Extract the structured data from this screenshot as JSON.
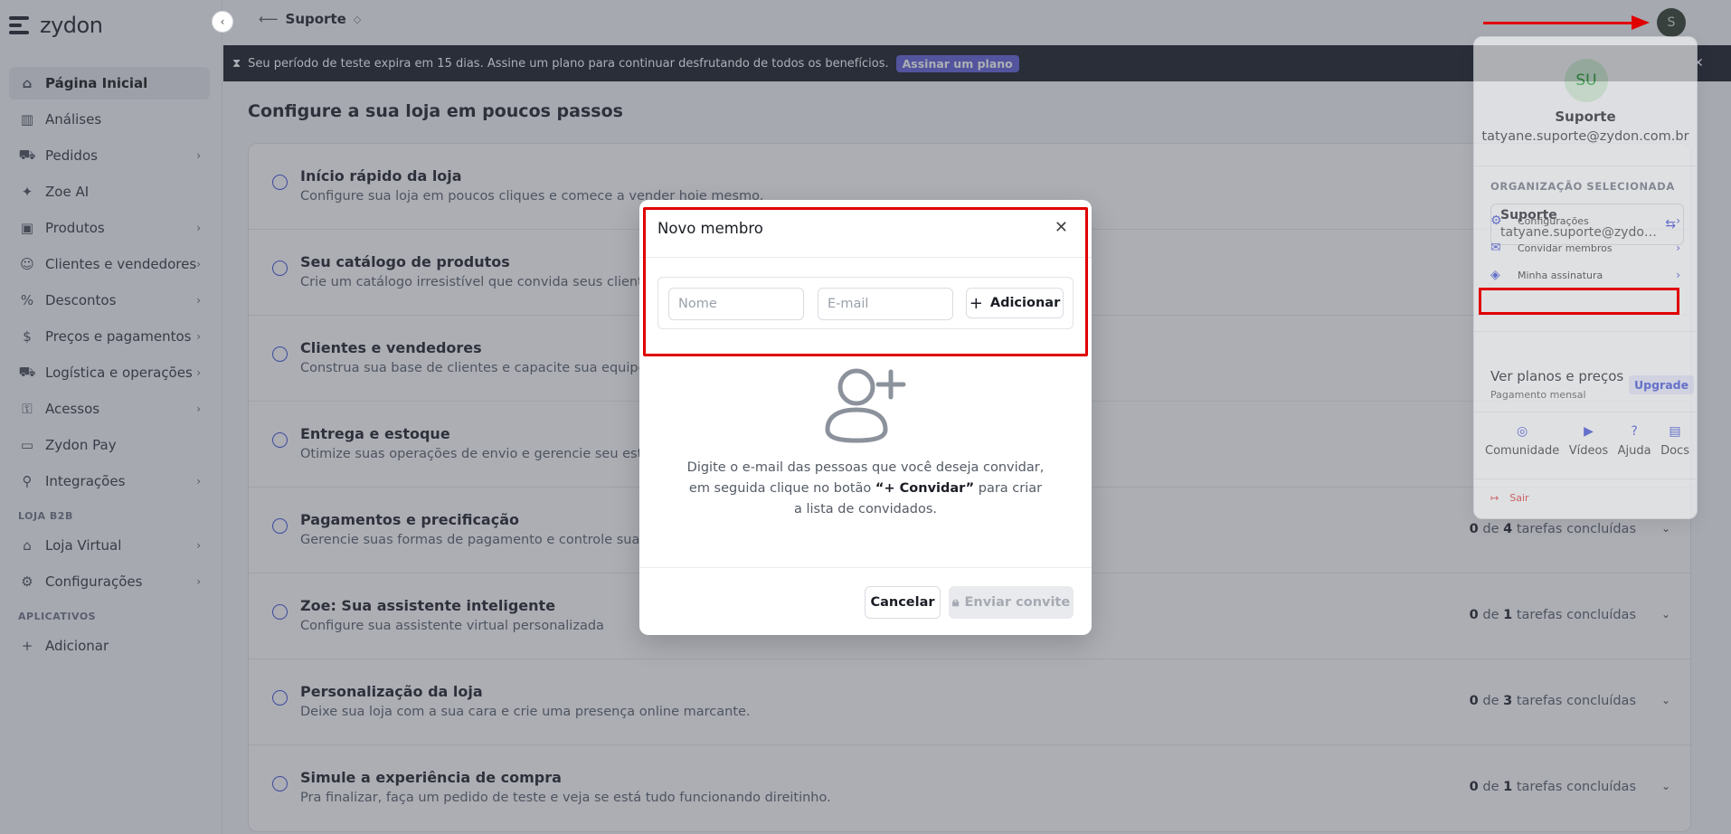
{
  "brand": {
    "name": "zydon"
  },
  "breadcrumb": {
    "back": "⟵",
    "title": "Suporte"
  },
  "user": {
    "initial": "S"
  },
  "sidebar": {
    "items": [
      {
        "label": "Página Inicial",
        "icon": "home-icon",
        "active": true,
        "chevron": false
      },
      {
        "label": "Análises",
        "icon": "bar-chart-icon",
        "chevron": false
      },
      {
        "label": "Pedidos",
        "icon": "cart-icon",
        "chevron": true
      },
      {
        "label": "Zoe AI",
        "icon": "sparkle-icon",
        "chevron": false
      },
      {
        "label": "Produtos",
        "icon": "box-icon",
        "chevron": true
      },
      {
        "label": "Clientes e vendedores",
        "icon": "users-icon",
        "chevron": true
      },
      {
        "label": "Descontos",
        "icon": "percent-icon",
        "chevron": true
      },
      {
        "label": "Preços e pagamentos",
        "icon": "dollar-icon",
        "chevron": true
      },
      {
        "label": "Logística e operações",
        "icon": "truck-icon",
        "chevron": true
      },
      {
        "label": "Acessos",
        "icon": "key-icon",
        "chevron": true
      },
      {
        "label": "Zydon Pay",
        "icon": "wallet-icon",
        "chevron": false
      },
      {
        "label": "Integrações",
        "icon": "plug-icon",
        "chevron": true
      }
    ],
    "section_b2b": "LOJA B2B",
    "b2b_items": [
      {
        "label": "Loja Virtual",
        "icon": "store-icon",
        "chevron": true
      },
      {
        "label": "Configurações",
        "icon": "gear-icon",
        "chevron": true
      }
    ],
    "section_apps": "APLICATIVOS",
    "apps_items": [
      {
        "label": "Adicionar",
        "icon": "plus-icon",
        "chevron": false
      }
    ]
  },
  "banner": {
    "text": "Seu período de teste expira em 15 dias. Assine um plano para continuar desfrutando de todos os benefícios.",
    "cta": "Assinar um plano"
  },
  "main": {
    "title": "Configure a sua loja em poucos passos",
    "tasks": [
      {
        "title": "Início rápido da loja",
        "desc": "Configure sua loja em poucos cliques e comece a vender hoje mesmo.",
        "done": "",
        "total": "",
        "suffix": ""
      },
      {
        "title": "Seu catálogo de produtos",
        "desc": "Crie um catálogo irresistível que convida seus clientes a comprar.",
        "done": "",
        "total": "",
        "suffix": ""
      },
      {
        "title": "Clientes e vendedores",
        "desc": "Construa sua base de clientes e capacite sua equipe de vendas.",
        "done": "",
        "total": "",
        "suffix": ""
      },
      {
        "title": "Entrega e estoque",
        "desc": "Otimize suas operações de envio e gerencie seu estoque.",
        "done": "",
        "total": "",
        "suffix": ""
      },
      {
        "title": "Pagamentos e precificação",
        "desc": "Gerencie suas formas de pagamento e controle suas tabelas de preço.",
        "done": "0",
        "total": "4",
        "suffix": "tarefas concluídas"
      },
      {
        "title": "Zoe: Sua assistente inteligente",
        "desc": "Configure sua assistente virtual personalizada",
        "done": "0",
        "total": "1",
        "suffix": "tarefas concluídas"
      },
      {
        "title": "Personalização da loja",
        "desc": "Deixe sua loja com a sua cara e crie uma presença online marcante.",
        "done": "0",
        "total": "3",
        "suffix": "tarefas concluídas"
      },
      {
        "title": "Simule a experiência de compra",
        "desc": "Pra finalizar, faça um pedido de teste e veja se está tudo funcionando direitinho.",
        "done": "0",
        "total": "1",
        "suffix": "tarefas concluídas"
      }
    ],
    "of_word": "de"
  },
  "user_panel": {
    "avatar": "SU",
    "name": "Suporte",
    "email": "tatyane.suporte@zydon.com.br",
    "org_section": "ORGANIZAÇÃO SELECIONADA",
    "org_name": "Suporte",
    "org_email": "tatyane.suporte@zydon.com.br",
    "menu": [
      {
        "label": "Configurações",
        "icon": "gear-icon"
      },
      {
        "label": "Convidar membros",
        "icon": "mail-icon"
      },
      {
        "label": "Minha assinatura",
        "icon": "tag-icon"
      }
    ],
    "plans_title": "Ver planos e preços",
    "plans_sub": "Pagamento mensal",
    "upgrade": "Upgrade",
    "links": [
      {
        "label": "Comunidade",
        "icon": "discord-icon"
      },
      {
        "label": "Vídeos",
        "icon": "video-icon"
      },
      {
        "label": "Ajuda",
        "icon": "help-icon"
      },
      {
        "label": "Docs",
        "icon": "folder-icon"
      }
    ],
    "logout": "Sair"
  },
  "modal": {
    "title": "Novo membro",
    "name_placeholder": "Nome",
    "email_placeholder": "E-mail",
    "add_label": "Adicionar",
    "empty_text_1": "Digite o e-mail das pessoas que você deseja convidar, em seguida clique no botão",
    "empty_text_quote": "“+ Convidar”",
    "empty_text_2": "para criar a lista de convidados.",
    "cancel": "Cancelar",
    "send": "Enviar convite"
  },
  "colors": {
    "accent": "#3b4bd6",
    "annotation": "#e00000",
    "banner_bg": "#11161f",
    "cta_bg": "#5b5cd6"
  }
}
